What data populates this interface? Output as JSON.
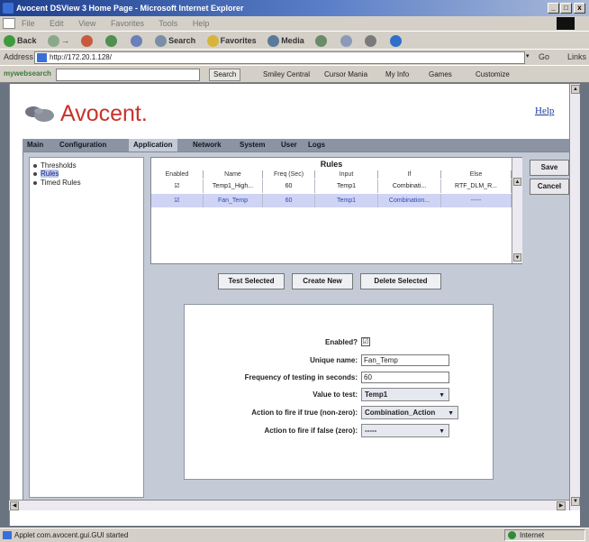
{
  "window": {
    "title": "Avocent DSView 3 Home Page - Microsoft Internet Explorer",
    "minimize": "_",
    "maximize": "□",
    "close": "x"
  },
  "menu": [
    "File",
    "Edit",
    "View",
    "Favorites",
    "Tools",
    "Help"
  ],
  "toolbar": {
    "back": "Back",
    "forward": "→",
    "search": "Search",
    "favorites": "Favorites",
    "media": "Media"
  },
  "address": {
    "label": "Address",
    "url": "http://172.20.1.128/",
    "go": "Go",
    "links": "Links"
  },
  "searchbar": {
    "brand": "mywebsearch",
    "search_button": "Search",
    "items": [
      "Smiley Central",
      "Cursor Mania",
      "My Info",
      "Games",
      "Customize"
    ]
  },
  "brand": {
    "logo_text": "Avocent.",
    "help_link": "Help"
  },
  "tabs": [
    {
      "label": "Main",
      "active": false
    },
    {
      "label": "Configuration",
      "active": false
    },
    {
      "label": "Application",
      "active": true
    },
    {
      "label": "Network",
      "active": false
    },
    {
      "label": "System",
      "active": false
    },
    {
      "label": "User",
      "active": false
    },
    {
      "label": "Logs",
      "active": false
    }
  ],
  "tree": [
    {
      "label": "Thresholds",
      "selected": false
    },
    {
      "label": "Rules",
      "selected": true
    },
    {
      "label": "Timed Rules",
      "selected": false
    }
  ],
  "rules": {
    "title": "Rules",
    "columns": [
      "Enabled",
      "Name",
      "Freq (Sec)",
      "Input",
      "If",
      "Else"
    ],
    "rows": [
      {
        "enabled": "☑",
        "name": "Temp1_High...",
        "freq": "60",
        "input": "Temp1",
        "if": "Combinati...",
        "else": "RTF_DLM_R...",
        "selected": false
      },
      {
        "enabled": "☑",
        "name": "Fan_Temp",
        "freq": "60",
        "input": "Temp1",
        "if": "Combination...",
        "else": "-----",
        "selected": true
      }
    ]
  },
  "buttons": {
    "save": "Save",
    "cancel": "Cancel",
    "test_selected": "Test Selected",
    "create_new": "Create New",
    "delete_selected": "Delete Selected"
  },
  "editor": {
    "enabled_label": "Enabled?",
    "enabled_mark": "☑",
    "name_label": "Unique name:",
    "name_value": "Fan_Temp",
    "freq_label": "Frequency of testing in seconds:",
    "freq_value": "60",
    "value_label": "Value to test:",
    "value_selected": "Temp1",
    "true_label": "Action to fire if true (non-zero):",
    "true_selected": "Combination_Action",
    "false_label": "Action to fire if false (zero):",
    "false_selected": "-----"
  },
  "status": {
    "text": "Applet com.avocent.gui.GUI started",
    "zone": "Internet"
  }
}
